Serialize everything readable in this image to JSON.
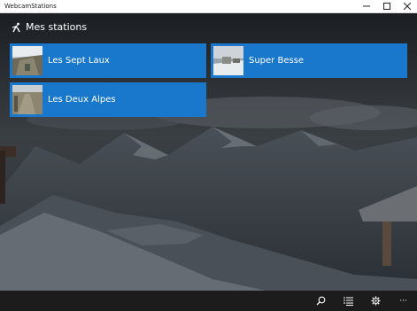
{
  "window": {
    "title": "WebcamStations",
    "minimize_icon": "minimize-icon",
    "maximize_icon": "maximize-icon",
    "close_icon": "close-icon"
  },
  "header": {
    "title": "Mes stations",
    "icon": "skier-icon"
  },
  "stations": [
    {
      "name": "Les Sept Laux"
    },
    {
      "name": "Super Besse"
    },
    {
      "name": "Les Deux Alpes"
    }
  ],
  "appbar": {
    "buttons": [
      "search-icon",
      "list-icon",
      "gear-icon",
      "more-icon"
    ],
    "more_label": "···"
  },
  "colors": {
    "tile": "#1a78cc",
    "appbar": "#1c1c1c"
  }
}
